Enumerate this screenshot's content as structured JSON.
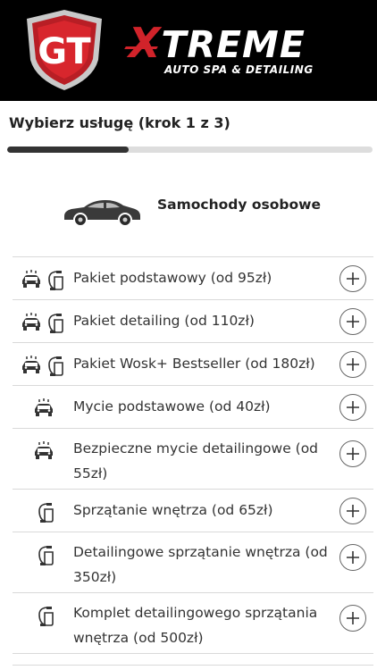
{
  "brand": {
    "name": "XTREME",
    "tagline": "AUTO SPA & DETAILING",
    "shield_text": "GT",
    "accent_color": "#d1232a"
  },
  "step": {
    "title": "Wybierz usługę (krok 1 z 3)",
    "progress": 0.333
  },
  "category": {
    "label": "Samochody osobowe",
    "icon": "car-icon"
  },
  "services": [
    {
      "label": "Pakiet podstawowy (od 95zł)",
      "icons": [
        "car-wash-icon",
        "vacuum-icon"
      ]
    },
    {
      "label": "Pakiet detailing (od 110zł)",
      "icons": [
        "car-wash-icon",
        "vacuum-icon"
      ]
    },
    {
      "label": "Pakiet Wosk+ Bestseller (od 180zł)",
      "icons": [
        "car-wash-icon",
        "vacuum-icon"
      ]
    },
    {
      "label": "Mycie podstawowe (od 40zł)",
      "icons": [
        "car-wash-icon"
      ]
    },
    {
      "label": "Bezpieczne mycie detailingowe (od 55zł)",
      "icons": [
        "car-wash-icon"
      ]
    },
    {
      "label": "Sprzątanie wnętrza (od 65zł)",
      "icons": [
        "vacuum-icon"
      ]
    },
    {
      "label": "Detailingowe sprzątanie wnętrza (od 350zł)",
      "icons": [
        "vacuum-icon"
      ]
    },
    {
      "label": "Komplet detailingowego sprzątania wnętrza (od 500zł)",
      "icons": [
        "vacuum-icon"
      ]
    }
  ],
  "add_icon": "plus-icon"
}
